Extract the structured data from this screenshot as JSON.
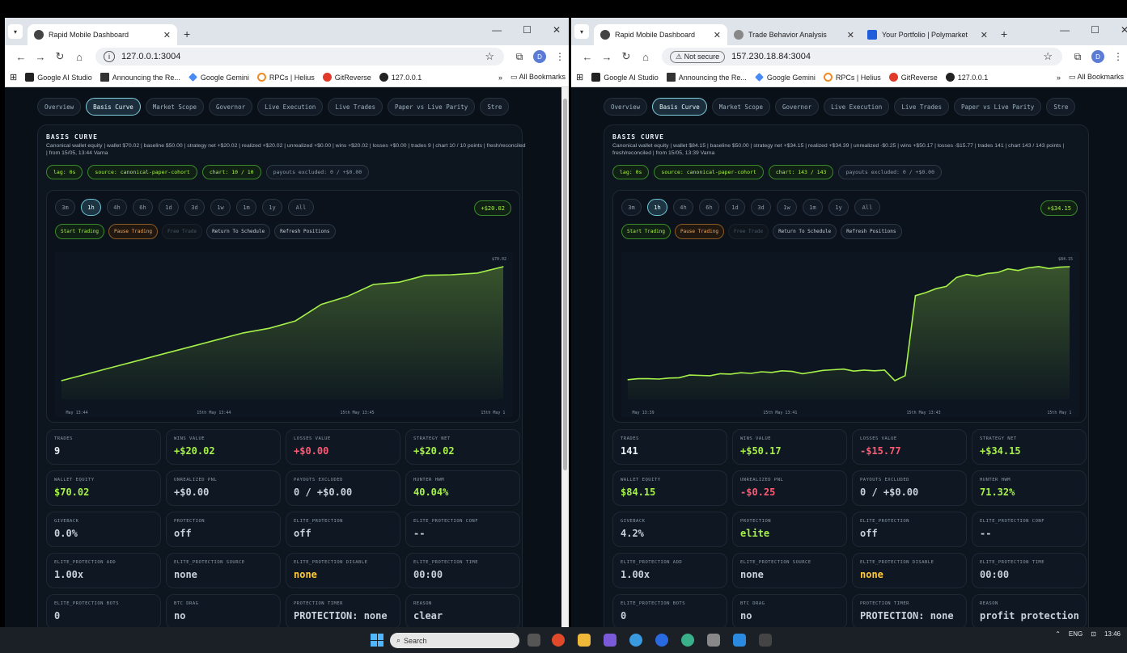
{
  "colors": {
    "accent": "#a6f04a",
    "loss": "#ff5a74",
    "warn": "#ffc93a",
    "bg": "#0a1018"
  },
  "windows": {
    "left": {
      "tabs": [
        {
          "label": "Rapid Mobile Dashboard",
          "icon": "globe-icon"
        }
      ],
      "newtab": "+",
      "url": "127.0.0.1:3004",
      "security": "",
      "bookmarks": [
        "Google AI Studio",
        "Announcing the Re...",
        "Google Gemini",
        "RPCs | Helius",
        "GitReverse",
        "127.0.0.1"
      ],
      "all_bookmarks": "All Bookmarks",
      "profile": "D",
      "nav": [
        "Overview",
        "Basis Curve",
        "Market Scope",
        "Governor",
        "Live Execution",
        "Live Trades",
        "Paper vs Live Parity",
        "Stre"
      ],
      "basis": {
        "title": "BASIS CURVE",
        "desc": "Canonical wallet equity | wallet $70.02 | baseline $50.00 | strategy net +$20.02 | realized +$20.02 | unrealized +$0.00 | wins +$20.02 | losses +$0.00 | trades 9 | chart 10 / 10 points | fresh/reconciled | from 15/05, 13:44 Varna",
        "pills": [
          "lag: 0s",
          "source: canonical-paper-cohort",
          "chart: 10 / 10",
          "payouts excluded: 0 / +$0.00"
        ],
        "ranges": [
          "3m",
          "1h",
          "4h",
          "6h",
          "1d",
          "3d",
          "1w",
          "1m",
          "1y",
          "All"
        ],
        "gain": "+$20.02",
        "actions": [
          "Start Trading",
          "Pause Trading",
          "Free Trade",
          "Return To Schedule",
          "Refresh Positions"
        ],
        "ymax_label": "$70.02",
        "xlabels": [
          "May 13:44",
          "15th May 13:44",
          "15th May 13:45",
          "15th May 1"
        ],
        "stats": [
          {
            "label": "TRADES",
            "value": "9"
          },
          {
            "label": "WINS VALUE",
            "value": "+$20.02"
          },
          {
            "label": "LOSSES VALUE",
            "value": "+$0.00"
          },
          {
            "label": "STRATEGY NET",
            "value": "+$20.02"
          },
          {
            "label": "WALLET EQUITY",
            "value": "$70.02"
          },
          {
            "label": "UNREALIZED PNL",
            "value": "+$0.00"
          },
          {
            "label": "PAYOUTS EXCLUDED",
            "value": "0 / +$0.00"
          },
          {
            "label": "HUNTER HWM",
            "value": "40.04%"
          },
          {
            "label": "GIVEBACK",
            "value": "0.0%"
          },
          {
            "label": "PROTECTION",
            "value": "off"
          },
          {
            "label": "ELITE_PROTECTION",
            "value": "off"
          },
          {
            "label": "ELITE_PROTECTION CONF",
            "value": "--"
          },
          {
            "label": "ELITE_PROTECTION ADD",
            "value": "1.00x"
          },
          {
            "label": "ELITE_PROTECTION SOURCE",
            "value": "none"
          },
          {
            "label": "ELITE_PROTECTION DISABLE",
            "value": "none"
          },
          {
            "label": "ELITE_PROTECTION TIME",
            "value": "00:00"
          },
          {
            "label": "ELITE_PROTECTION BOTS",
            "value": "0"
          },
          {
            "label": "BTC DRAG",
            "value": "no"
          },
          {
            "label": "PROTECTION TIMER",
            "value": "PROTECTION: none"
          },
          {
            "label": "REASON",
            "value": "clear"
          }
        ]
      }
    },
    "right": {
      "tabs": [
        {
          "label": "Rapid Mobile Dashboard",
          "icon": "globe-icon"
        },
        {
          "label": "Trade Behavior Analysis",
          "icon": "globe-icon"
        },
        {
          "label": "Your Portfolio | Polymarket",
          "icon": "polymarket-icon"
        }
      ],
      "newtab": "+",
      "url": "157.230.18.84:3004",
      "security": "Not secure",
      "bookmarks": [
        "Google AI Studio",
        "Announcing the Re...",
        "Google Gemini",
        "RPCs | Helius",
        "GitReverse",
        "127.0.0.1"
      ],
      "all_bookmarks": "All Bookmarks",
      "profile": "D",
      "nav": [
        "Overview",
        "Basis Curve",
        "Market Scope",
        "Governor",
        "Live Execution",
        "Live Trades",
        "Paper vs Live Parity",
        "Stre"
      ],
      "basis": {
        "title": "BASIS CURVE",
        "desc": "Canonical wallet equity | wallet $84.15 | baseline $50.00 | strategy net +$34.15 | realized +$34.39 | unrealized -$0.25 | wins +$50.17 | losses -$15.77 | trades 141 | chart 143 / 143 points | fresh/reconciled | from 15/05, 13:39 Varna",
        "pills": [
          "lag: 0s",
          "source: canonical-paper-cohort",
          "chart: 143 / 143",
          "payouts excluded: 0 / +$0.00"
        ],
        "ranges": [
          "3m",
          "1h",
          "4h",
          "6h",
          "1d",
          "3d",
          "1w",
          "1m",
          "1y",
          "All"
        ],
        "gain": "+$34.15",
        "actions": [
          "Start Trading",
          "Pause Trading",
          "Free Trade",
          "Return To Schedule",
          "Refresh Positions"
        ],
        "ymax_label": "$84.15",
        "xlabels": [
          "May 13:39",
          "15th May 13:41",
          "15th May 13:43",
          "15th May 1"
        ],
        "stats": [
          {
            "label": "TRADES",
            "value": "141"
          },
          {
            "label": "WINS VALUE",
            "value": "+$50.17"
          },
          {
            "label": "LOSSES VALUE",
            "value": "-$15.77"
          },
          {
            "label": "STRATEGY NET",
            "value": "+$34.15"
          },
          {
            "label": "WALLET EQUITY",
            "value": "$84.15"
          },
          {
            "label": "UNREALIZED PNL",
            "value": "-$0.25"
          },
          {
            "label": "PAYOUTS EXCLUDED",
            "value": "0 / +$0.00"
          },
          {
            "label": "HUNTER HWM",
            "value": "71.32%"
          },
          {
            "label": "GIVEBACK",
            "value": "4.2%"
          },
          {
            "label": "PROTECTION",
            "value": "elite"
          },
          {
            "label": "ELITE_PROTECTION",
            "value": "off"
          },
          {
            "label": "ELITE_PROTECTION CONF",
            "value": "--"
          },
          {
            "label": "ELITE_PROTECTION ADD",
            "value": "1.00x"
          },
          {
            "label": "ELITE_PROTECTION SOURCE",
            "value": "none"
          },
          {
            "label": "ELITE_PROTECTION DISABLE",
            "value": "none"
          },
          {
            "label": "ELITE_PROTECTION TIME",
            "value": "00:00"
          },
          {
            "label": "ELITE_PROTECTION BOTS",
            "value": "0"
          },
          {
            "label": "BTC DRAG",
            "value": "no"
          },
          {
            "label": "PROTECTION TIMER",
            "value": "PROTECTION: none"
          },
          {
            "label": "REASON",
            "value": "profit protection"
          }
        ]
      }
    }
  },
  "taskbar": {
    "search_placeholder": "Search",
    "clock": "13:46",
    "lang": "ENG"
  },
  "chart_data": [
    {
      "type": "line",
      "title": "",
      "ylabel": "",
      "y": [
        50.0,
        51.2,
        52.4,
        53.6,
        54.8,
        56.0,
        57.2,
        58.4,
        59.2,
        60.5,
        63.4,
        64.8,
        66.9,
        67.3,
        68.5,
        68.6,
        68.9,
        70.02
      ],
      "ylim": [
        50,
        70.02
      ]
    },
    {
      "type": "line",
      "title": "",
      "ylabel": "",
      "y": [
        50.0,
        50.3,
        50.3,
        50.2,
        50.5,
        50.6,
        51.4,
        51.3,
        51.2,
        51.8,
        51.7,
        52.1,
        51.9,
        52.4,
        52.2,
        52.7,
        52.5,
        51.8,
        52.3,
        52.8,
        53.0,
        53.2,
        52.6,
        52.9,
        52.7,
        52.9,
        49.7,
        51.2,
        75.4,
        76.3,
        77.5,
        78.2,
        80.9,
        81.8,
        81.3,
        82.1,
        82.4,
        83.5,
        83.0,
        83.8,
        84.2,
        83.6,
        84.0,
        84.15
      ],
      "ylim": [
        49.7,
        84.15
      ]
    }
  ]
}
